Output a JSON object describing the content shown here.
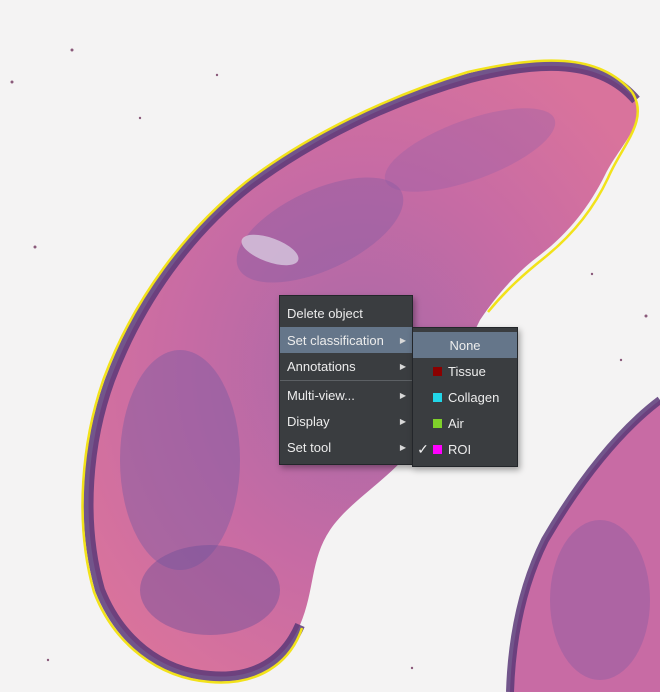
{
  "context_menu": {
    "items": [
      {
        "label": "Delete object",
        "has_submenu": false
      },
      {
        "label": "Set classification",
        "has_submenu": true,
        "highlighted": true
      },
      {
        "label": "Annotations",
        "has_submenu": true
      },
      {
        "label": "Multi-view...",
        "has_submenu": true
      },
      {
        "label": "Display",
        "has_submenu": true
      },
      {
        "label": "Set tool",
        "has_submenu": true
      }
    ],
    "submenu_arrow": "▶"
  },
  "classification_submenu": {
    "items": [
      {
        "label": "None",
        "highlighted": true
      },
      {
        "label": "Tissue",
        "color": "#8b0000"
      },
      {
        "label": "Collagen",
        "color": "#22d6e8"
      },
      {
        "label": "Air",
        "color": "#7fd12a"
      },
      {
        "label": "ROI",
        "color": "#ff00ff",
        "checked": true
      }
    ],
    "check_mark": "✓"
  },
  "colors": {
    "annotation_outline": "#f2e21a",
    "tissue_stain": "#d05a93",
    "nuclei_stain": "#6b4a93",
    "menu_background": "#3a3d40",
    "menu_highlight": "#65768a"
  }
}
